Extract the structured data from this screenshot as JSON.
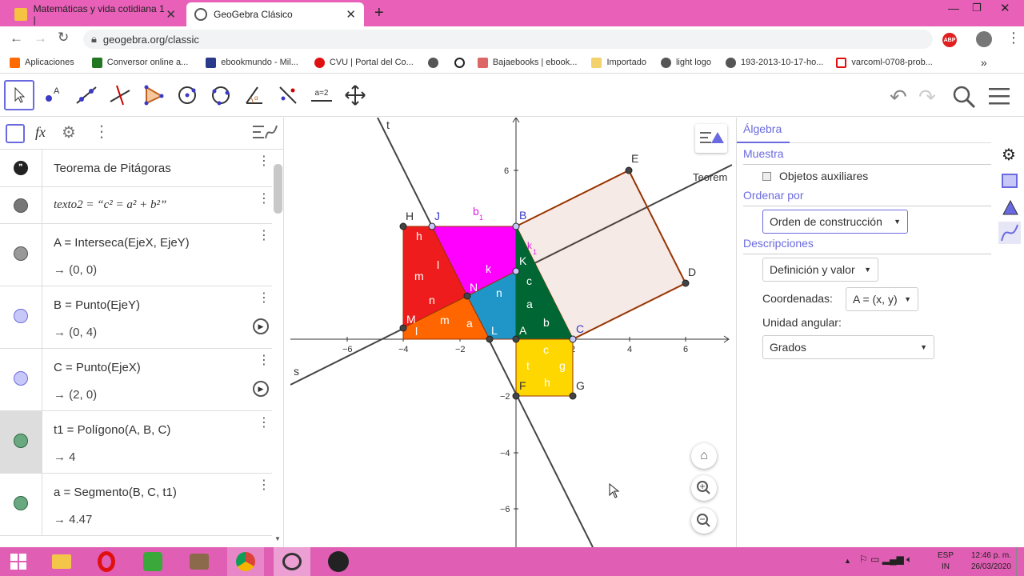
{
  "browser": {
    "tabs": [
      {
        "title": "Matemáticas y vida cotidiana 1 |"
      },
      {
        "title": "GeoGebra Clásico"
      }
    ],
    "url": "geogebra.org/classic",
    "abp": "ABP",
    "bookmarks": [
      "Aplicaciones",
      "Conversor online a...",
      "ebookmundo - Mil...",
      "CVU | Portal del Co...",
      "",
      "Bajaebooks | ebook...",
      "Importado",
      "light logo",
      "193-2013-10-17-ho...",
      "varcoml-0708-prob..."
    ]
  },
  "toolbar": {
    "equal_tool": "a=2"
  },
  "algebra": {
    "rows": [
      {
        "l1": "Teorema de Pitágoras"
      },
      {
        "l1": "texto2 = “c² = a² + b²”"
      },
      {
        "l1": "A = Interseca(EjeX, EjeY)",
        "l2": "→  (0, 0)"
      },
      {
        "l1": "B = Punto(EjeY)",
        "l2": "→  (0, 4)"
      },
      {
        "l1": "C = Punto(EjeX)",
        "l2": "→  (2, 0)"
      },
      {
        "l1": "t1 = Polígono(A, B, C)",
        "l2": "→  4"
      },
      {
        "l1": "a = Segmento(B, C, t1)",
        "l2": "→  4.47"
      }
    ]
  },
  "graphics": {
    "ticks_x": [
      "−6",
      "−4",
      "−2",
      "2",
      "4",
      "6"
    ],
    "ticks_y": [
      "6",
      "−2",
      "−4",
      "−6"
    ],
    "labels": {
      "t": "t",
      "s": "s",
      "H": "H",
      "J": "J",
      "B": "B",
      "b1": "b",
      "E": "E",
      "D": "D",
      "C": "C",
      "K": "K",
      "k1": "k",
      "M": "M",
      "N": "N",
      "L": "L",
      "A": "A",
      "F": "F",
      "G": "G",
      "teorema": "Teorem",
      "sub1": "1"
    },
    "piece_labels": [
      "h",
      "m",
      "l",
      "n",
      "m",
      "k",
      "n",
      "c",
      "a",
      "b",
      "l",
      "a",
      "c",
      "t",
      "g",
      "h",
      "j",
      "n",
      "l",
      "m",
      "n",
      "a",
      "b"
    ]
  },
  "properties": {
    "tab": "Álgebra",
    "muestra": "Muestra",
    "aux": "Objetos auxiliares",
    "ordenar": "Ordenar por",
    "orden_value": "Orden de construcción",
    "descripciones": "Descripciones",
    "desc_value": "Definición y valor",
    "coordenadas_label": "Coordenadas:",
    "coordenadas_value": "A = (x, y)",
    "unidad_label": "Unidad angular:",
    "unidad_value": "Grados"
  },
  "taskbar": {
    "lang1": "ESP",
    "lang2": "IN",
    "time": "12:46 p. m.",
    "date": "26/03/2020"
  },
  "colors": {
    "tabbar": "#e860b8",
    "accent": "#6a6ae0",
    "red": "#ee1c1c",
    "magenta": "#ff00ff",
    "green": "#006633",
    "orange": "#ff6600",
    "blue": "#1f95c8",
    "yellow": "#ffd700"
  }
}
